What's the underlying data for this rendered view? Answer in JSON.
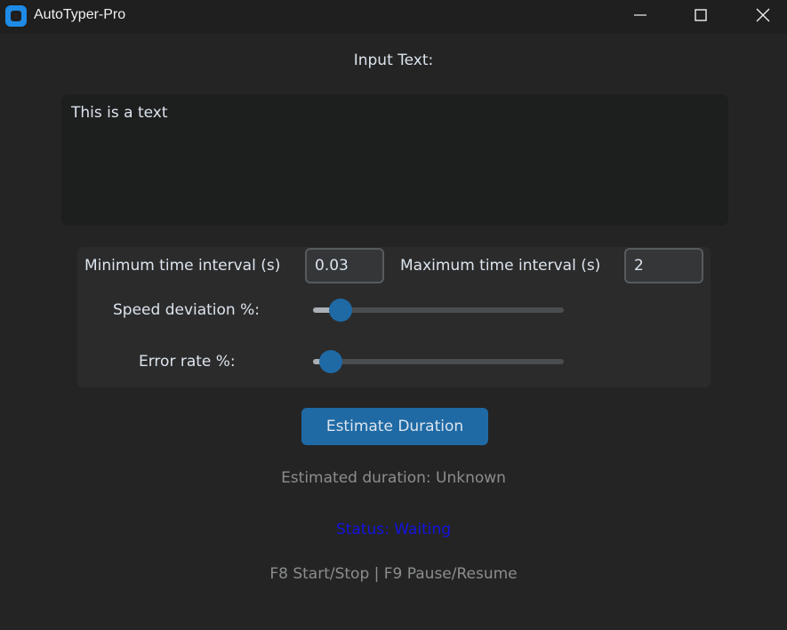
{
  "window": {
    "title": "AutoTyper-Pro",
    "icon": "app-icon",
    "controls": [
      "minimize-icon",
      "maximize-icon",
      "close-icon"
    ]
  },
  "input": {
    "label": "Input Text:",
    "value": "This is a text"
  },
  "settings": {
    "min_interval_label": "Minimum time interval (s)",
    "min_interval_value": "0.03",
    "max_interval_label": "Maximum time interval (s)",
    "max_interval_value": "2",
    "speed_label": "Speed deviation %:",
    "speed_value_fraction": 0.11,
    "error_label": "Error rate %:",
    "error_value_fraction": 0.07
  },
  "actions": {
    "estimate_button": "Estimate Duration"
  },
  "info": {
    "estimated_duration": "Estimated duration: Unknown",
    "status": "Status: Waiting",
    "hotkeys": "F8 Start/Stop | F9 Pause/Resume"
  },
  "colors": {
    "accent": "#1f6aa5",
    "status": "#1414e0",
    "background": "#242424"
  }
}
